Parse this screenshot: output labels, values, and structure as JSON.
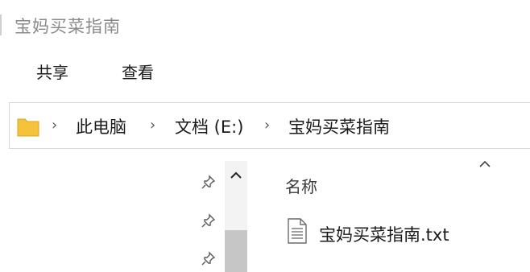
{
  "window": {
    "title": "宝妈买菜指南"
  },
  "ribbon": {
    "tabs": [
      "共享",
      "查看"
    ]
  },
  "address_bar": {
    "crumbs": [
      "此电脑",
      "文档 (E:)",
      "宝妈买菜指南"
    ]
  },
  "file_list": {
    "column_name": "名称",
    "items": [
      {
        "name": "宝妈买菜指南.txt",
        "icon": "text-file-icon"
      }
    ]
  },
  "colors": {
    "folder": "#f5c33b",
    "scroll_thumb": "#c6c6c6",
    "accent_text": "#8a8a8a"
  }
}
